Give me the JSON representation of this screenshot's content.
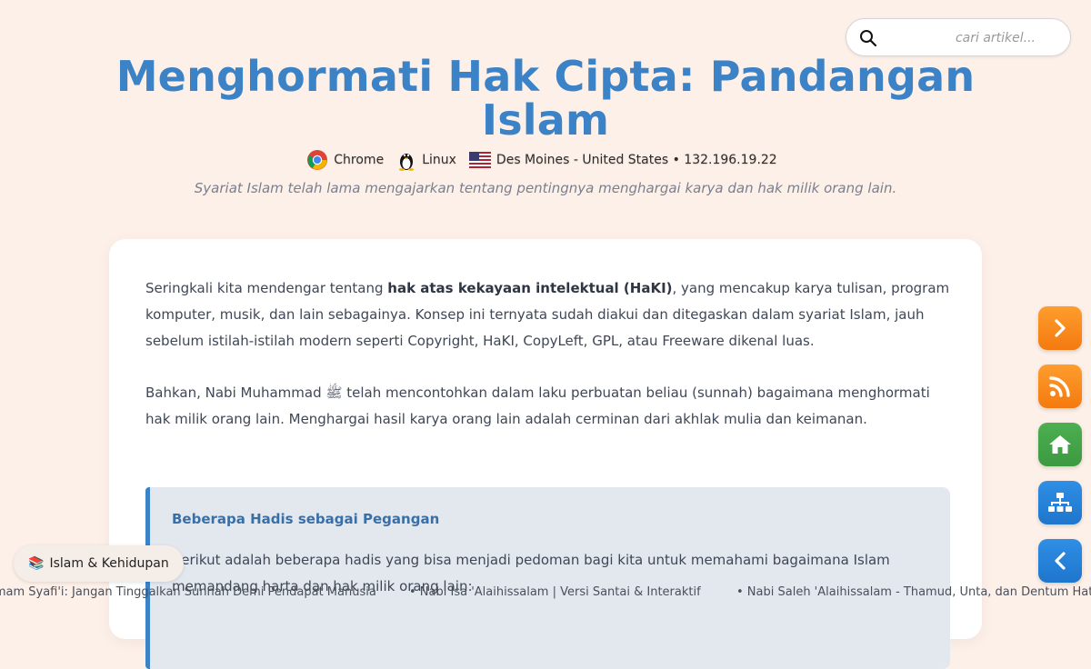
{
  "search": {
    "placeholder": "cari artikel..."
  },
  "article": {
    "title": "Menghormati Hak Cipta: Pandangan Islam",
    "subtitle": "Syariat Islam telah lama mengajarkan tentang pentingnya menghargai karya dan hak milik orang lain."
  },
  "meta": {
    "browser": "Chrome",
    "os": "Linux",
    "location": "Des Moines - United States • 132.196.19.22"
  },
  "content": {
    "p1_before": "Seringkali kita mendengar tentang ",
    "p1_bold": "hak atas kekayaan intelektual (HaKI)",
    "p1_after": ", yang mencakup karya tulisan, program komputer, musik, dan lain sebagainya. Konsep ini ternyata sudah diakui dan ditegaskan dalam syariat Islam, jauh sebelum istilah-istilah modern seperti Copyright, HaKI, CopyLeft, GPL, atau Freeware dikenal luas.",
    "p2": "Bahkan, Nabi Muhammad ﷺ telah mencontohkan dalam laku perbuatan beliau (sunnah) bagaimana menghormati hak milik orang lain. Menghargai hasil karya orang lain adalah cerminan dari akhlak mulia dan keimanan."
  },
  "callout": {
    "heading": "Beberapa Hadis sebagai Pegangan",
    "text": "Berikut adalah beberapa hadis yang bisa menjadi pedoman bagi kita untuk memahami bagaimana Islam memandang harta dan hak milik orang lain:"
  },
  "category_badge": {
    "emoji": "📚",
    "label": "Islam & Kehidupan"
  },
  "ticker": [
    "Imam Syafi'i: Jangan Tinggalkan Sunnah Demi Pendapat Manusia",
    "• Nabi Isa 'Alaihissalam | Versi Santai & Interaktif",
    "• Nabi Saleh 'Alaihissalam - Thamud, Unta, dan Dentum Hati"
  ],
  "side_buttons": [
    "chevron-right-icon",
    "rss-icon",
    "home-icon",
    "sitemap-icon",
    "chevron-left-icon"
  ],
  "colors": {
    "accent": "#3b82c7",
    "background": "#fdf0e8",
    "orange": "#f47a0f",
    "green": "#3c9a40",
    "blue": "#1f76cc"
  }
}
